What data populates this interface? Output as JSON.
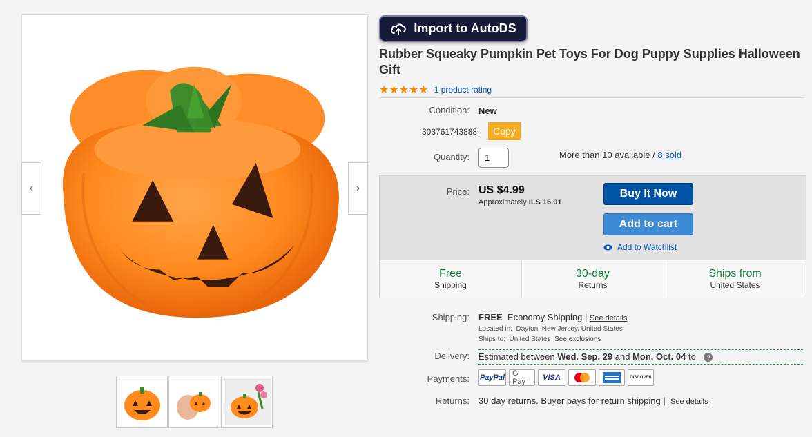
{
  "product": {
    "title": "Rubber Squeaky Pumpkin Pet Toys For Dog Puppy Supplies Halloween Gift",
    "rating_link": "1 product rating",
    "stars": "★★★★★",
    "condition_label": "Condition:",
    "condition_value": "New",
    "item_number": "303761743888",
    "copy_label": "Copy",
    "quantity_label": "Quantity:",
    "quantity_value": "1",
    "availability_text": "More than 10 available / ",
    "sold_link": "8 sold"
  },
  "toolbar": {
    "import_label": "Import to AutoDS",
    "import_icon": "cloud-upload-icon"
  },
  "gallery": {
    "prev_arrow": "‹",
    "next_arrow": "›",
    "thumbnails": [
      "pumpkin-front",
      "pumpkin-in-hand",
      "pumpkin-with-flowers"
    ]
  },
  "price_box": {
    "price_label": "Price:",
    "price_value": "US $4.99",
    "approx_prefix": "Approximately ",
    "approx_value": "ILS 16.01",
    "buy_now_label": "Buy It Now",
    "add_to_cart_label": "Add to cart",
    "watchlist_label": "Add to Watchlist",
    "features": [
      {
        "title": "Free",
        "subtitle": "Shipping"
      },
      {
        "title": "30-day",
        "subtitle": "Returns"
      },
      {
        "title": "Ships from",
        "subtitle": "United States"
      }
    ]
  },
  "shipping": {
    "label": "Shipping:",
    "free": "FREE",
    "method": "Economy Shipping",
    "separator": "|",
    "details_link": "See details",
    "located_label": "Located in:",
    "located_value": "Dayton, New Jersey, United States",
    "ships_to_label": "Ships to:",
    "ships_to_value": "United States",
    "exclusions_link": "See exclusions"
  },
  "delivery": {
    "label": "Delivery:",
    "prefix": "Estimated between ",
    "start": "Wed. Sep. 29",
    "mid": " and ",
    "end": "Mon. Oct. 04",
    "suffix": " to",
    "help_icon": "?"
  },
  "payments": {
    "label": "Payments:",
    "methods": [
      "PayPal",
      "G Pay",
      "VISA",
      "Mastercard",
      "American Express",
      "DISCOVER"
    ]
  },
  "returns": {
    "label": "Returns:",
    "text": "30 day returns. Buyer pays for return shipping",
    "separator": "|",
    "details_link": "See details"
  },
  "colors": {
    "accent_blue": "#0054a3",
    "cart_blue": "#3d8ad7",
    "link_blue": "#0654ba",
    "star_orange": "#f18c00",
    "feature_green": "#16813a",
    "copy_yellow": "#f5ae1f",
    "import_navy": "#181a3a"
  }
}
